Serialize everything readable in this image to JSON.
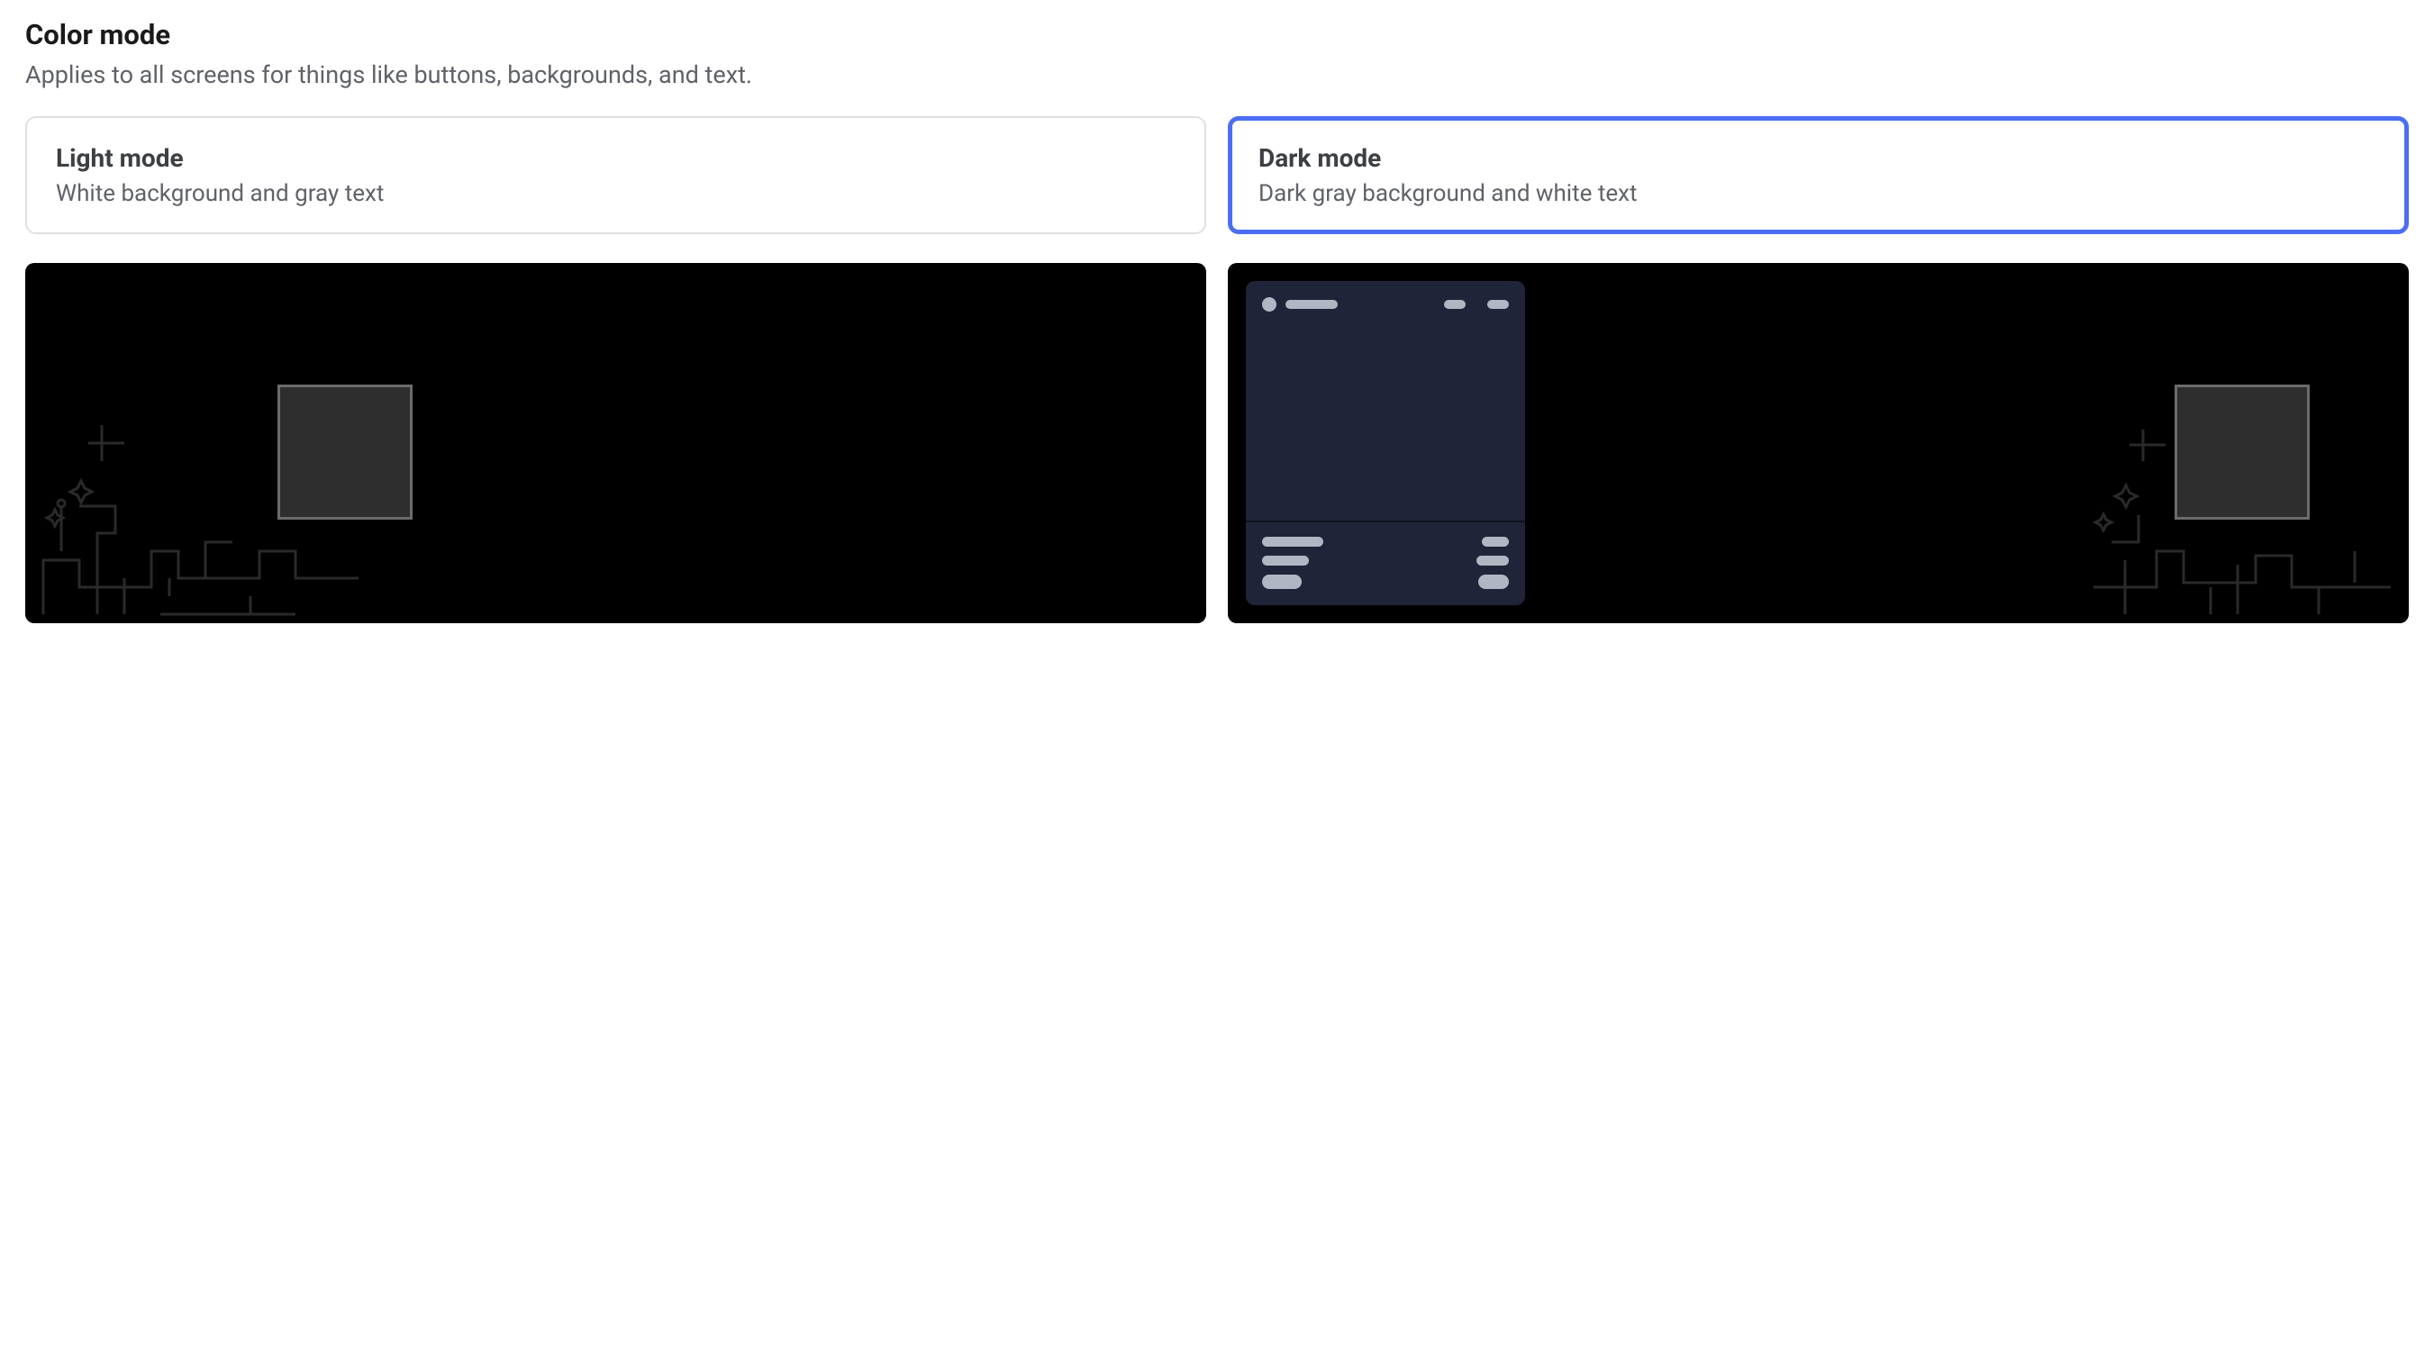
{
  "section": {
    "title": "Color mode",
    "subtitle": "Applies to all screens for things like buttons, backgrounds, and text."
  },
  "options": {
    "light": {
      "title": "Light mode",
      "description": "White background and gray text",
      "selected": false
    },
    "dark": {
      "title": "Dark mode",
      "description": "Dark gray background and white text",
      "selected": true
    }
  },
  "colors": {
    "accent_selected": "#4c6ef5",
    "border_default": "#e0e0e0",
    "text_primary": "#1a1a1a",
    "text_muted": "#5f6368",
    "preview_background": "#000000",
    "mock_panel_background": "#1f2438",
    "mock_placeholder": "#b0b6c3"
  }
}
